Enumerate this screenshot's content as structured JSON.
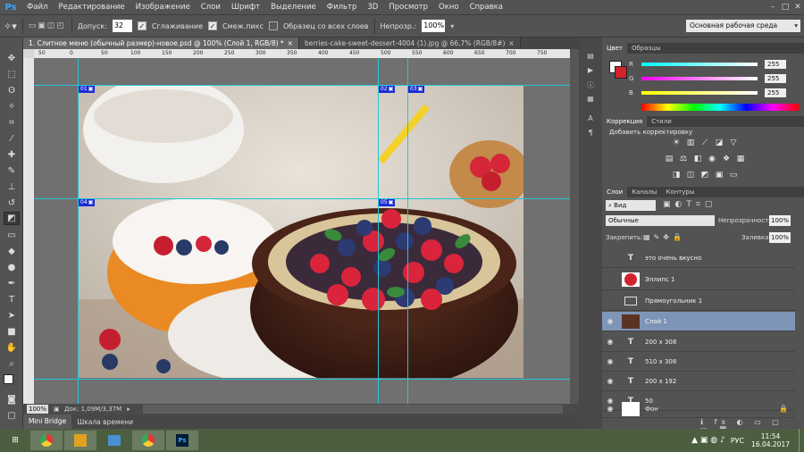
{
  "app": {
    "logo": "Ps"
  },
  "menu": [
    "Файл",
    "Редактирование",
    "Изображение",
    "Слои",
    "Шрифт",
    "Выделение",
    "Фильтр",
    "3D",
    "Просмотр",
    "Окно",
    "Справка"
  ],
  "options": {
    "tolerance_label": "Допуск:",
    "tolerance_value": "32",
    "antialias_label": "Сглаживание",
    "contiguous_label": "Смеж.пикс",
    "sample_all_label": "Образец со всех слоев",
    "opacity_label": "Непрозр.:",
    "opacity_value": "100%",
    "workspace": "Основная рабочая среда"
  },
  "tabs": [
    {
      "label": "1. Слитное меню (обычный размер)-новое.psd @ 100% (Слой 1, RGB/8) *",
      "active": true
    },
    {
      "label": "berries-cake-sweet-dessert-4004 (1).jpg @ 66,7% (RGB/8#)",
      "active": false
    }
  ],
  "ruler": [
    "50",
    "0",
    "50",
    "100",
    "150",
    "200",
    "250",
    "300",
    "350",
    "400",
    "450",
    "500",
    "550",
    "600",
    "650",
    "700",
    "750"
  ],
  "slices": [
    "01",
    "02",
    "03",
    "04",
    "05"
  ],
  "status": {
    "zoom": "100%",
    "doc": "Док: 1,09M/3,37M"
  },
  "bottom_tabs": [
    "Mini Bridge",
    "Шкала времени"
  ],
  "color_panel": {
    "tabs": [
      "Цвет",
      "Образцы"
    ],
    "r_label": "R",
    "g_label": "G",
    "b_label": "B",
    "r": "255",
    "g": "255",
    "b": "255",
    "fg": "#ffffff",
    "bg": "#d2232a"
  },
  "adjust_panel": {
    "tabs": [
      "Коррекция",
      "Стили"
    ],
    "heading": "Добавить корректировку"
  },
  "layers_panel": {
    "tabs": [
      "Слои",
      "Каналы",
      "Контуры"
    ],
    "kind_filter": "Вид",
    "blend_mode": "Обычные",
    "opacity_label": "Непрозрачность:",
    "opacity_value": "100%",
    "lock_label": "Закрепить:",
    "fill_label": "Заливка:",
    "fill_value": "100%",
    "layers": [
      {
        "name": "это очень вкусно",
        "type": "text",
        "visible": false,
        "selected": false
      },
      {
        "name": "Эллипс 1",
        "type": "ellipse",
        "visible": false,
        "selected": false
      },
      {
        "name": "Прямоугольник 1",
        "type": "rect",
        "visible": false,
        "selected": false
      },
      {
        "name": "Слой 1",
        "type": "image",
        "visible": true,
        "selected": true
      },
      {
        "name": "200 x 308",
        "type": "text",
        "visible": true,
        "selected": false
      },
      {
        "name": "510 x 308",
        "type": "text",
        "visible": true,
        "selected": false
      },
      {
        "name": "200 x 192",
        "type": "text",
        "visible": true,
        "selected": false
      },
      {
        "name": "50",
        "type": "text",
        "visible": true,
        "selected": false
      },
      {
        "name": "Фон",
        "type": "bg",
        "visible": true,
        "selected": false
      }
    ]
  },
  "taskbar": {
    "lang": "РУС",
    "time": "11:54",
    "date": "16.04.2017"
  }
}
